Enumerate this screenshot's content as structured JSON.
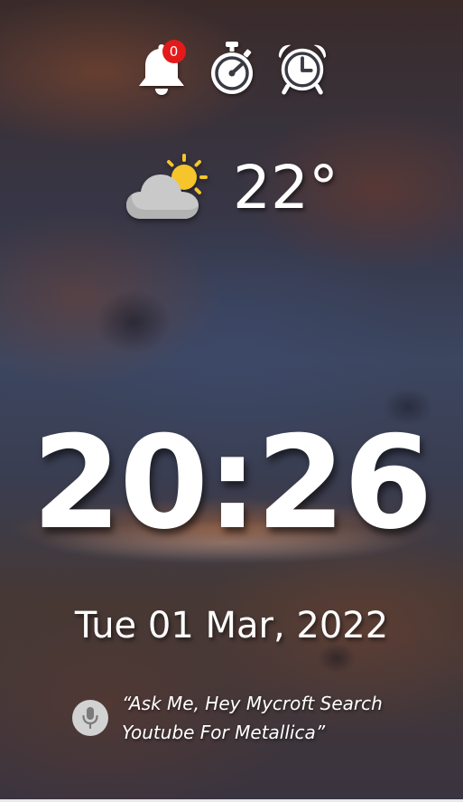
{
  "notifications": {
    "count": "0",
    "icon": "bell-icon",
    "badge_color": "#e31a1a"
  },
  "top_icons": [
    "bell-icon",
    "stopwatch-icon",
    "alarm-clock-icon"
  ],
  "weather": {
    "icon": "partly-cloudy-icon",
    "temperature": "22°"
  },
  "clock": {
    "time": "20:26"
  },
  "date": {
    "text": "Tue 01 Mar, 2022"
  },
  "voice_hint": {
    "icon": "microphone-icon",
    "line1": "“Ask Me, Hey Mycroft Search",
    "line2": "Youtube For Metallica”"
  }
}
